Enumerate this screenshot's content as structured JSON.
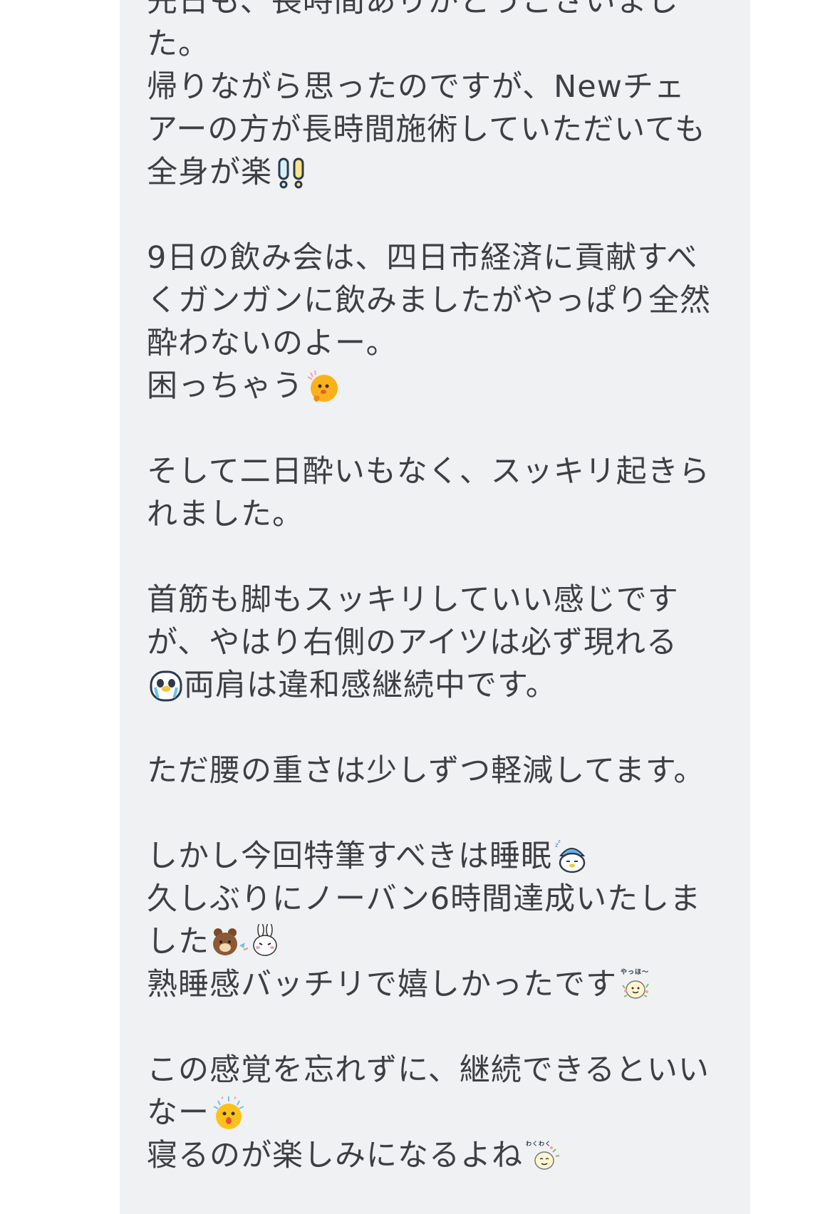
{
  "message": {
    "lines": {
      "l01": "先日も、長時間ありがとうございまし",
      "l02": "た。",
      "l03": "帰りながら思ったのですが、Newチェ",
      "l04": "アーの方が長時間施術していただいても",
      "l05": "全身が楽",
      "l07": "9日の飲み会は、四日市経済に貢献すべ",
      "l08": "くガンガンに飲みましたがやっぱり全然",
      "l09": "酔わないのよー。",
      "l10": "困っちゃう",
      "l12": "そして二日酔いもなく、スッキリ起きら",
      "l13": "れました。",
      "l15": "首筋も脚もスッキリしていい感じです",
      "l16": "が、やはり右側のアイツは必ず現れる",
      "l17": "両肩は違和感継続中です。",
      "l19": "ただ腰の重さは少しずつ軽減してます。",
      "l21": "しかし今回特筆すべきは睡眠",
      "l22": "久しぶりにノーバン6時間達成いたしま",
      "l23": "した",
      "l24": "熟睡感バッチリで嬉しかったです",
      "l26": "この感覚を忘れずに、継続できるといい",
      "l27": "なー",
      "l28": "寝るのが楽しみになるよね"
    },
    "emoji_names": {
      "double_exclamation": "double-exclamation-icon",
      "troubled_face": "troubled-face-sticker-icon",
      "crying_face": "crying-bird-sticker-icon",
      "sleeping": "sleeping-bird-nightcap-icon",
      "bear_bunny": "brown-and-cony-sticker-icon",
      "yahho": "yahho-sticker-icon",
      "surprised": "surprised-face-sticker-icon",
      "wakuwaku": "wakuwaku-sticker-icon"
    },
    "emoji_texts": {
      "yahho": "やっほ〜",
      "wakuwaku": "わくわく"
    }
  },
  "colors": {
    "bubble_background": "#f0f1f3",
    "text": "#3e3f44",
    "page_background": "#ffffff"
  }
}
